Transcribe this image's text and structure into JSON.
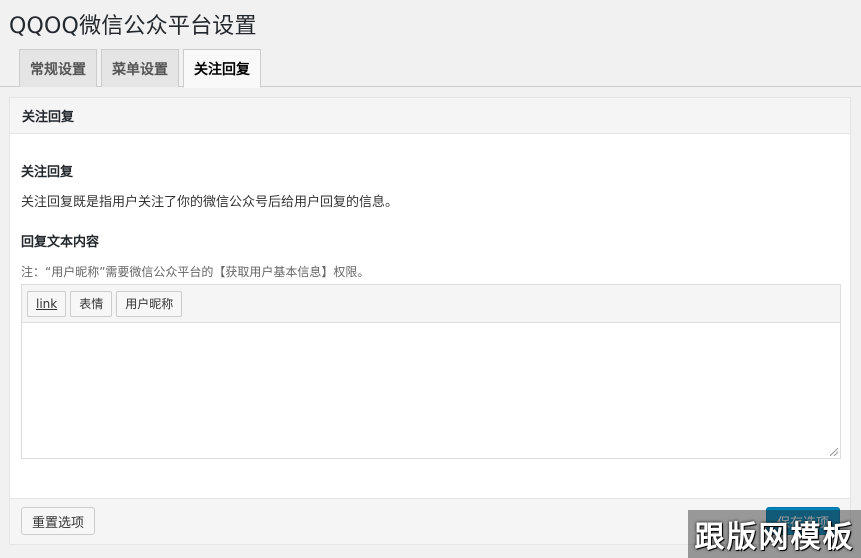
{
  "page": {
    "title": "QQOQ微信公众平台设置"
  },
  "tabs": [
    {
      "label": "常规设置",
      "active": false
    },
    {
      "label": "菜单设置",
      "active": false
    },
    {
      "label": "关注回复",
      "active": true
    }
  ],
  "panel": {
    "header": "关注回复",
    "section1_title": "关注回复",
    "section1_desc": "关注回复既是指用户关注了你的微信公众号后给用户回复的信息。",
    "section2_title": "回复文本内容",
    "note": "注：“用户昵称”需要微信公众平台的【获取用户基本信息】权限。",
    "editor": {
      "buttons": [
        "link",
        "表情",
        "用户昵称"
      ],
      "value": ""
    }
  },
  "footer": {
    "reset_label": "重置选项",
    "save_label": "保存选项"
  },
  "watermark": {
    "text": "跟版网模板"
  },
  "colors": {
    "accent": "#0085ba",
    "background": "#f1f1f1"
  }
}
